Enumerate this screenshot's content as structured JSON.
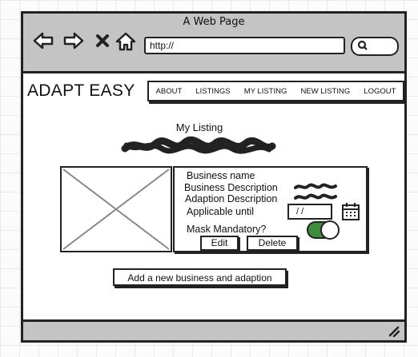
{
  "window": {
    "title": "A Web Page"
  },
  "browser": {
    "address": "http://",
    "icons": [
      "back-arrow-icon",
      "forward-arrow-icon",
      "close-icon",
      "home-icon",
      "search-icon",
      "resize-grip-icon"
    ]
  },
  "brand": "ADAPT EASY",
  "nav": {
    "items": [
      "ABOUT",
      "LISTINGS",
      "MY LISTING",
      "NEW LISTING",
      "LOGOUT"
    ]
  },
  "listing": {
    "title": "My Listing",
    "fields": {
      "business_name": "Business name",
      "business_description": "Business Description",
      "adaption_description": "Adaption Description",
      "applicable_until": "Applicable until",
      "mask_mandatory": "Mask Mandatory?"
    },
    "date_value": "/ /",
    "mask_toggle": true,
    "edit_label": "Edit",
    "delete_label": "Delete"
  },
  "add_button": "Add a new business and adaption",
  "colors": {
    "chrome": "#c4c4c4",
    "toggle_on": "#3f8c3f"
  }
}
